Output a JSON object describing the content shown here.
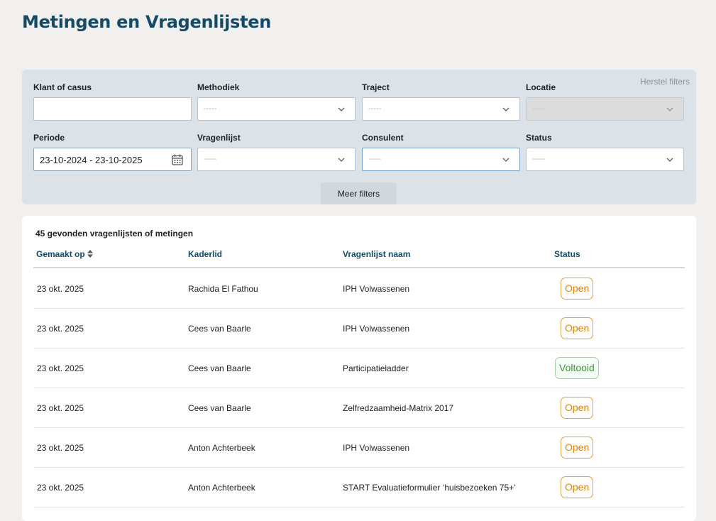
{
  "page": {
    "title": "Metingen en Vragenlijsten"
  },
  "filters": {
    "reset_label": "Herstel filters",
    "klant": {
      "label": "Klant of casus",
      "value": ""
    },
    "methodiek": {
      "label": "Methodiek",
      "placeholder": "-----"
    },
    "traject": {
      "label": "Traject",
      "placeholder": "-----"
    },
    "locatie": {
      "label": "Locatie",
      "placeholder": "-----"
    },
    "periode": {
      "label": "Periode",
      "value": "23-10-2024 - 23-10-2025"
    },
    "vragenlijst": {
      "label": "Vragenlijst",
      "placeholder": "-----"
    },
    "consulent": {
      "label": "Consulent",
      "placeholder": "-----"
    },
    "status": {
      "label": "Status",
      "placeholder": "-----"
    },
    "more_label": "Meer filters"
  },
  "results": {
    "count_text": "45 gevonden vragenlijsten of metingen",
    "columns": {
      "created": "Gemaakt op",
      "member": "Kaderlid",
      "questionnaire": "Vragenlijst naam",
      "status": "Status"
    },
    "rows": [
      {
        "created": "23 okt. 2025",
        "member": "Rachida El Fathou",
        "questionnaire": "IPH Volwassenen",
        "status": "Open"
      },
      {
        "created": "23 okt. 2025",
        "member": "Cees van Baarle",
        "questionnaire": "IPH Volwassenen",
        "status": "Open"
      },
      {
        "created": "23 okt. 2025",
        "member": "Cees van Baarle",
        "questionnaire": "Participatieladder",
        "status": "Voltooid"
      },
      {
        "created": "23 okt. 2025",
        "member": "Cees van Baarle",
        "questionnaire": "Zelfredzaamheid-Matrix 2017",
        "status": "Open"
      },
      {
        "created": "23 okt. 2025",
        "member": "Anton Achterbeek",
        "questionnaire": "IPH Volwassenen",
        "status": "Open"
      },
      {
        "created": "23 okt. 2025",
        "member": "Anton Achterbeek",
        "questionnaire": "START Evaluatieformulier ‘huisbezoeken 75+’",
        "status": "Open"
      }
    ]
  },
  "colors": {
    "title": "#154a66",
    "panel_bg": "#dce3e8",
    "status_open": "#d98614",
    "status_done": "#3c9a3c"
  },
  "icons": {
    "chevron": "chevron-down-icon",
    "calendar": "calendar-icon",
    "sort": "sort-icon"
  }
}
